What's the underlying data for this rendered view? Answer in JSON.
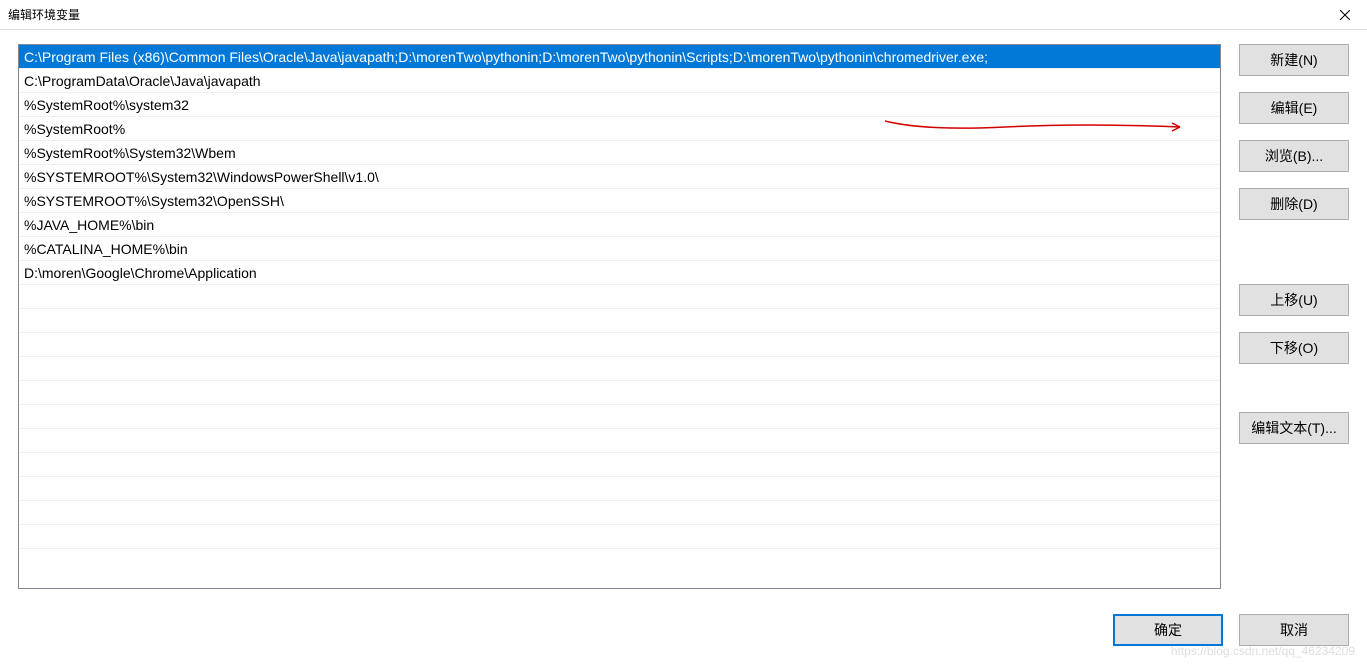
{
  "title": "编辑环境变量",
  "list_items": [
    "C:\\Program Files (x86)\\Common Files\\Oracle\\Java\\javapath;D:\\morenTwo\\pythonin;D:\\morenTwo\\pythonin\\Scripts;D:\\morenTwo\\pythonin\\chromedriver.exe;",
    "C:\\ProgramData\\Oracle\\Java\\javapath",
    "%SystemRoot%\\system32",
    "%SystemRoot%",
    "%SystemRoot%\\System32\\Wbem",
    "%SYSTEMROOT%\\System32\\WindowsPowerShell\\v1.0\\",
    "%SYSTEMROOT%\\System32\\OpenSSH\\",
    "%JAVA_HOME%\\bin",
    "%CATALINA_HOME%\\bin",
    "D:\\moren\\Google\\Chrome\\Application"
  ],
  "selected_index": 0,
  "buttons": {
    "new": "新建(N)",
    "edit": "编辑(E)",
    "browse": "浏览(B)...",
    "delete": "删除(D)",
    "moveup": "上移(U)",
    "movedown": "下移(O)",
    "edittext": "编辑文本(T)...",
    "ok": "确定",
    "cancel": "取消"
  },
  "watermark": "https://blog.csdn.net/qq_46234209"
}
